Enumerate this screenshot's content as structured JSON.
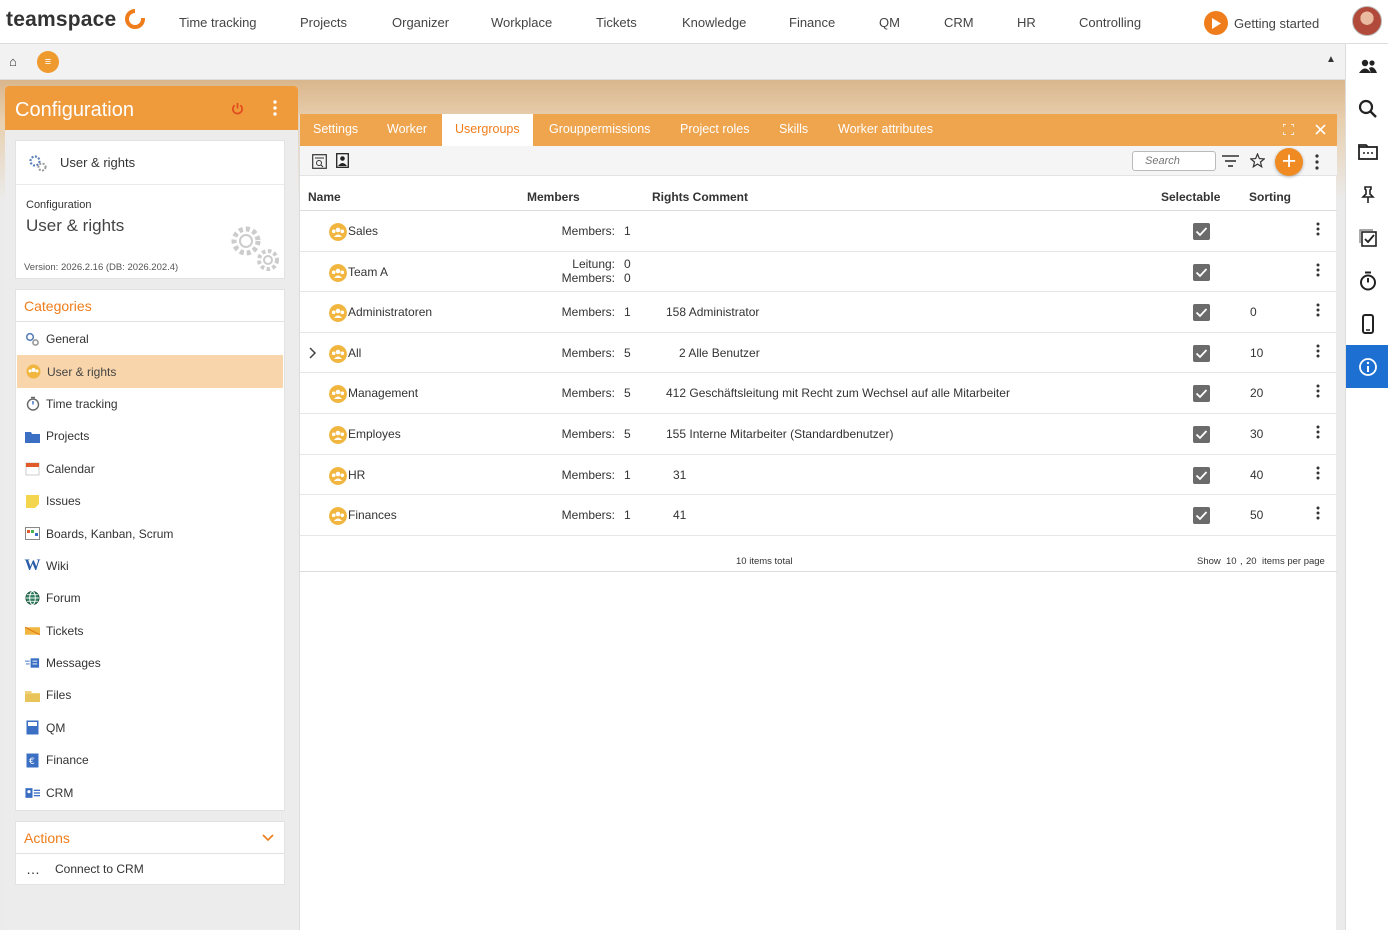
{
  "brand": {
    "name": "teamspace",
    "accent": "#ef7d1b"
  },
  "topnav": {
    "items": [
      "Time tracking",
      "Projects",
      "Organizer",
      "Workplace",
      "Tickets",
      "Knowledge",
      "Finance",
      "QM",
      "CRM",
      "HR",
      "Controlling"
    ],
    "getting_started": "Getting started"
  },
  "rail": {
    "icons": [
      "people-icon",
      "search-icon",
      "folder-icon",
      "pin-icon",
      "checklist-icon",
      "stopwatch-icon",
      "phone-icon",
      "info-icon"
    ],
    "active": "info-icon"
  },
  "left_panel": {
    "title": "Configuration",
    "current": {
      "label": "User & rights"
    },
    "info": {
      "small": "Configuration",
      "big": "User & rights",
      "version": "Version: 2026.2.16 (DB: 2026.202.4)"
    },
    "categories_title": "Categories",
    "categories": [
      "General",
      "User & rights",
      "Time tracking",
      "Projects",
      "Calendar",
      "Issues",
      "Boards, Kanban, Scrum",
      "Wiki",
      "Forum",
      "Tickets",
      "Messages",
      "Files",
      "QM",
      "Finance",
      "CRM"
    ],
    "selected_category": "User & rights",
    "actions_title": "Actions",
    "actions": [
      "Connect to CRM"
    ]
  },
  "dialog": {
    "tabs": [
      "Settings",
      "Worker",
      "Usergroups",
      "Grouppermissions",
      "Project roles",
      "Skills",
      "Worker attributes"
    ],
    "active_tab": "Usergroups",
    "search_placeholder": "Search",
    "columns": {
      "name": "Name",
      "members": "Members",
      "rights_comment": "Rights Comment",
      "selectable": "Selectable",
      "sorting": "Sorting"
    },
    "rows": [
      {
        "name": "Sales",
        "member_lines": [
          {
            "label": "Members:",
            "value": "1"
          }
        ],
        "rights": "",
        "selectable": true,
        "sorting": ""
      },
      {
        "name": "Team A",
        "member_lines": [
          {
            "label": "Leitung:",
            "value": "0"
          },
          {
            "label": "Members:",
            "value": "0"
          }
        ],
        "rights": "",
        "selectable": true,
        "sorting": ""
      },
      {
        "name": "Administratoren",
        "member_lines": [
          {
            "label": "Members:",
            "value": "1"
          }
        ],
        "rights": "158 Administrator",
        "selectable": true,
        "sorting": "0"
      },
      {
        "name": "All",
        "member_lines": [
          {
            "label": "Members:",
            "value": "5"
          }
        ],
        "rights": "2 Alle Benutzer",
        "selectable": true,
        "sorting": "10",
        "expandable": true
      },
      {
        "name": "Management",
        "member_lines": [
          {
            "label": "Members:",
            "value": "5"
          }
        ],
        "rights": "412 Geschäftsleitung mit Recht zum Wechsel auf alle Mitarbeiter",
        "selectable": true,
        "sorting": "20"
      },
      {
        "name": "Employes",
        "member_lines": [
          {
            "label": "Members:",
            "value": "5"
          }
        ],
        "rights": "155 Interne Mitarbeiter (Standardbenutzer)",
        "selectable": true,
        "sorting": "30"
      },
      {
        "name": "HR",
        "member_lines": [
          {
            "label": "Members:",
            "value": "1"
          }
        ],
        "rights": "31",
        "selectable": true,
        "sorting": "40"
      },
      {
        "name": "Finances",
        "member_lines": [
          {
            "label": "Members:",
            "value": "1"
          }
        ],
        "rights": "41",
        "selectable": true,
        "sorting": "50"
      }
    ],
    "footer": {
      "total": "10 items total",
      "show": "Show",
      "page_sizes": [
        "10",
        "20"
      ],
      "per_page": "items per page"
    }
  }
}
